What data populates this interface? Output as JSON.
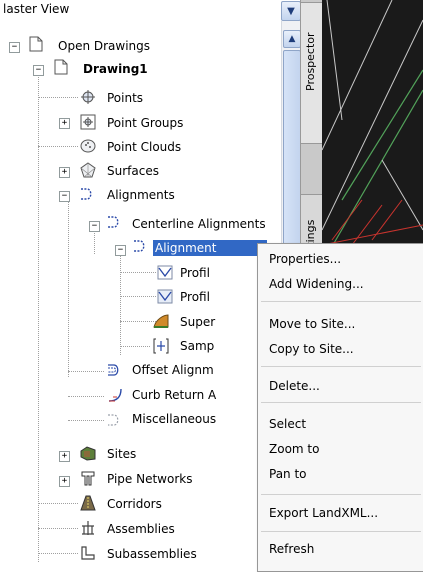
{
  "panel": {
    "view_selector": "laster View",
    "tabs": {
      "prospector": "Prospector",
      "settings": "ttings"
    }
  },
  "tree": {
    "open_drawings": "Open Drawings",
    "drawing1": "Drawing1",
    "points": "Points",
    "point_groups": "Point Groups",
    "point_clouds": "Point Clouds",
    "surfaces": "Surfaces",
    "alignments": "Alignments",
    "centerline_alignments": "Centerline Alignments",
    "alignment_selected": "Alignment",
    "profiles1": "Profil",
    "profiles2": "Profil",
    "superelevation": "Super",
    "sample_lines": "Samp",
    "offset_alignments": "Offset Alignm",
    "curb_return": "Curb Return A",
    "miscellaneous": "Miscellaneous",
    "sites": "Sites",
    "pipe_networks": "Pipe Networks",
    "corridors": "Corridors",
    "assemblies": "Assemblies",
    "subassemblies": "Subassemblies"
  },
  "context_menu": {
    "properties": "Properties...",
    "add_widening": "Add Widening...",
    "move_to_site": "Move to Site...",
    "copy_to_site": "Copy to Site...",
    "delete": "Delete...",
    "select": "Select",
    "zoom_to": "Zoom to",
    "pan_to": "Pan to",
    "export_landxml": "Export LandXML...",
    "refresh": "Refresh"
  },
  "colors": {
    "selection": "#3168c5",
    "drawing_background": "#1a1a1a",
    "alignment_line": "#c8342e",
    "green_line": "#52a35a"
  }
}
